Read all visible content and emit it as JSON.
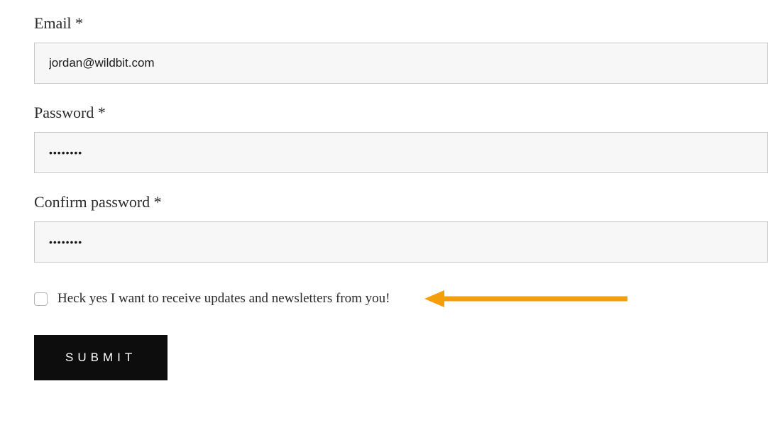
{
  "form": {
    "email": {
      "label": "Email *",
      "value": "jordan@wildbit.com"
    },
    "password": {
      "label": "Password *",
      "value": "••••••••"
    },
    "confirm_password": {
      "label": "Confirm password *",
      "value": "••••••••"
    },
    "newsletter": {
      "label": "Heck yes I want to receive updates and newsletters from you!",
      "checked": false
    },
    "submit_label": "SUBMIT"
  },
  "annotation": {
    "arrow_color": "#f59e0b"
  }
}
